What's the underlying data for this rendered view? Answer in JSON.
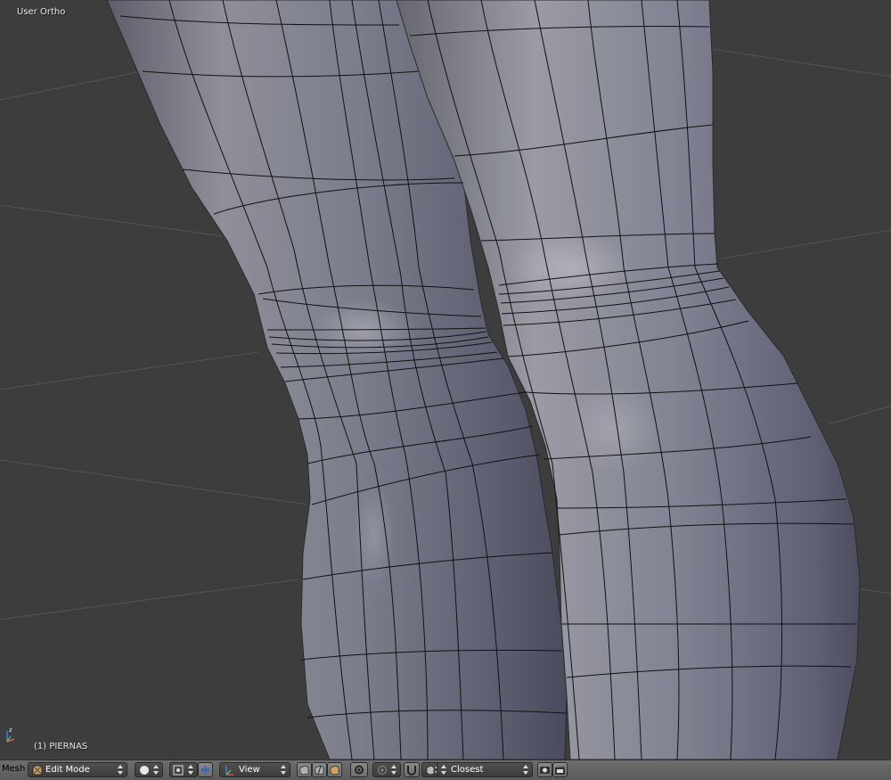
{
  "viewport": {
    "view_name": "User Ortho",
    "object_name": "(1) PIERNAS",
    "axes": {
      "x": "x",
      "y": "y",
      "z": "z"
    }
  },
  "header": {
    "editor_menu": "Mesh",
    "mode": "Edit Mode",
    "shading": "solid-sphere-icon",
    "pivot": "pivot-point-icon",
    "orientation": "View",
    "snap_target": "Closest"
  },
  "colors": {
    "background": "#3d3d3d",
    "mesh_surface": "#8a8b9a",
    "wire": "#000000",
    "header": "#646464"
  }
}
